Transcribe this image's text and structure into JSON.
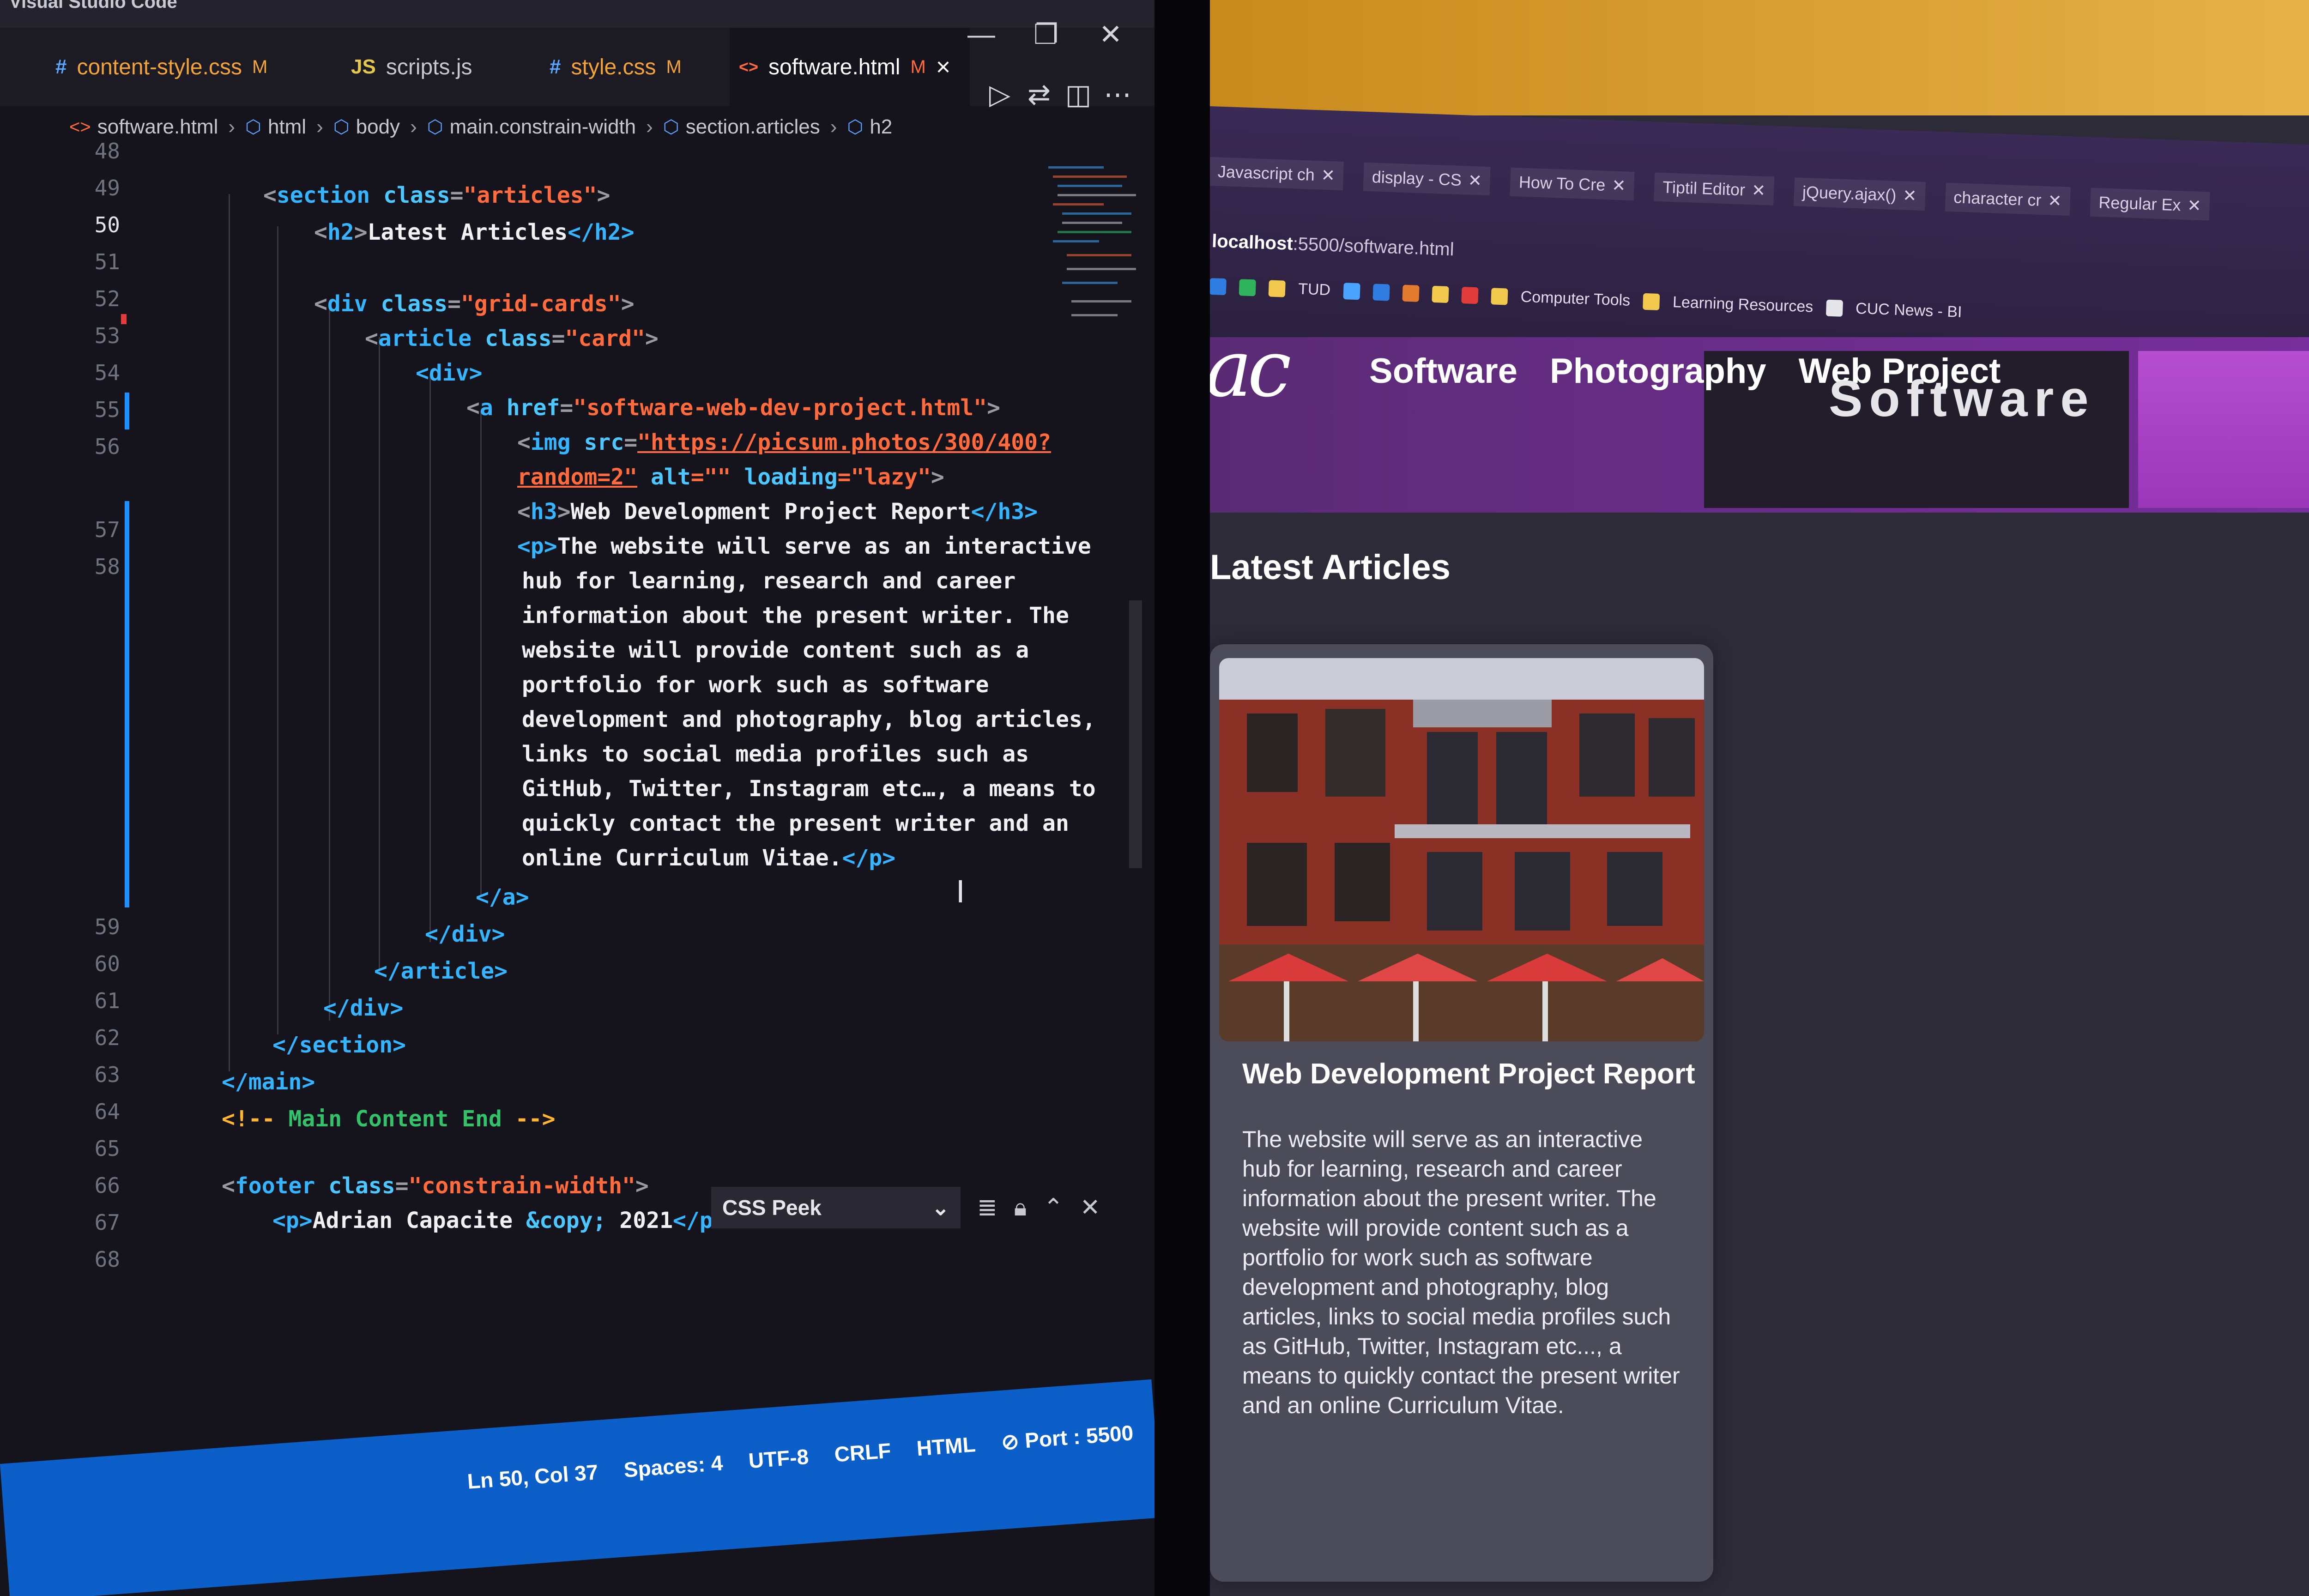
{
  "editor": {
    "app_title": "Visual Studio Code",
    "tabs": [
      {
        "icon": "#",
        "label": "content-style.css",
        "status": "M",
        "color": "#f2a33a"
      },
      {
        "icon": "JS",
        "label": "scripts.js",
        "status": "",
        "color": "#e3c94b"
      },
      {
        "icon": "#",
        "label": "style.css",
        "status": "M",
        "color": "#f2a33a"
      },
      {
        "icon": "<>",
        "label": "software.html",
        "status": "M",
        "color": "#ff6a3d"
      }
    ],
    "active_tab_close": "×",
    "window_controls": {
      "minimize": "—",
      "restore": "❐",
      "close": "✕"
    },
    "breadcrumb": [
      "software.html",
      "html",
      "body",
      "main.constrain-width",
      "section.articles",
      "h2"
    ],
    "line_numbers": [
      "48",
      "49",
      "50",
      "51",
      "52",
      "53",
      "54",
      "55",
      "56",
      "57",
      "58",
      "59",
      "60",
      "61",
      "62",
      "63",
      "64",
      "65",
      "66",
      "67",
      "68"
    ],
    "current_line": "50",
    "code": {
      "l49": {
        "open": "<",
        "tag": "section",
        "attr": "class",
        "eq": "=",
        "val": "\"articles\"",
        "close": ">"
      },
      "l50": {
        "open": "<",
        "tag": "h2",
        "close": ">",
        "text": "Latest Articles",
        "end": "</h2>"
      },
      "l52": {
        "open": "<",
        "tag": "div",
        "attr": "class",
        "eq": "=",
        "val": "\"grid-cards\"",
        "close": ">"
      },
      "l53": {
        "open": "<",
        "tag": "article",
        "attr": "class",
        "eq": "=",
        "val": "\"card\"",
        "close": ">"
      },
      "l54": {
        "text": "<div>"
      },
      "l55": {
        "open": "<",
        "tag": "a",
        "attr": "href",
        "eq": "=",
        "val": "\"software-web-dev-project.html\"",
        "close": ">"
      },
      "l56a": {
        "open": "<",
        "tag": "img",
        "attr": "src",
        "eq": "=",
        "val": "\"https://picsum.photos/300/400?"
      },
      "l56b": {
        "val": "random=2\"",
        "attr2": "alt",
        "val2": "=\"\"",
        "attr3": "loading",
        "val3": "=\"lazy\"",
        "close": ">"
      },
      "l57": {
        "open": "<",
        "tag": "h3",
        "close": ">",
        "text": "Web Development Project Report",
        "end": "</h3>"
      },
      "l58_open": "<p>",
      "l58_lines": [
        "The website will serve as an interactive",
        "hub for learning, research and career",
        "information about the present writer. The",
        "website will provide content such as a",
        "portfolio for work such as software",
        "development and photography, blog articles,",
        "links to social media profiles such as",
        "GitHub, Twitter, Instagram etc…, a means to",
        "quickly contact the present writer and an",
        "online Curriculum Vitae."
      ],
      "l58_close": "</p>",
      "l_a_close": "</a>",
      "l59": "</div>",
      "l60": "</article>",
      "l61": "</div>",
      "l62": "</section>",
      "l63": "</main>",
      "l64": {
        "open": "<!--",
        "text": "Main Content End",
        "close": "-->"
      },
      "l66": {
        "open": "<",
        "tag": "footer",
        "attr": "class",
        "eq": "=",
        "val": "\"constrain-width\"",
        "close": ">"
      },
      "l67": {
        "open": "<p>",
        "text": "Adrian Capacite",
        "ent": "&copy;",
        "year": "2021",
        "close": "</p>"
      }
    },
    "css_peek": {
      "label": "CSS Peek",
      "chevron": "⌄"
    },
    "statusbar": [
      "Ln 50, Col 37",
      "Spaces: 4",
      "UTF-8",
      "CRLF",
      "HTML",
      "⊘ Port : 5500"
    ],
    "colors": {
      "accent_blue": "#0c5ec9",
      "tag": "#35b4ff",
      "string": "#ff6b3d",
      "comment": "#33c26a"
    }
  },
  "browser": {
    "tabs": [
      "Javascript ch",
      "display - CS",
      "How To Cre",
      "Tiptil Editor",
      "jQuery.ajax()",
      "character cr",
      "Regular Ex"
    ],
    "address": {
      "host": "localhost",
      "path": ":5500/software.html"
    },
    "bookmarks": [
      "TUD",
      "Computer Tools",
      "Learning Resources",
      "CUC News - BI"
    ],
    "site": {
      "logo": "ac",
      "nav": [
        "Software",
        "Photography",
        "Web Project"
      ],
      "hero_title": "Software",
      "latest_heading": "Latest Articles",
      "card_title": "Web Development Project Report",
      "card_text": "The website will serve as an interactive hub for learning, research and career information about the present writer. The website will provide content such as a portfolio for work such as software development and photography, blog articles, links to social media profiles such as GitHub, Twitter, Instagram etc..., a means to quickly contact the present writer and an online Curriculum Vitae."
    },
    "colors": {
      "header_purple": "#7a2fa0",
      "card_bg": "#4c4b5a",
      "page_bg": "#2d2b38"
    }
  }
}
